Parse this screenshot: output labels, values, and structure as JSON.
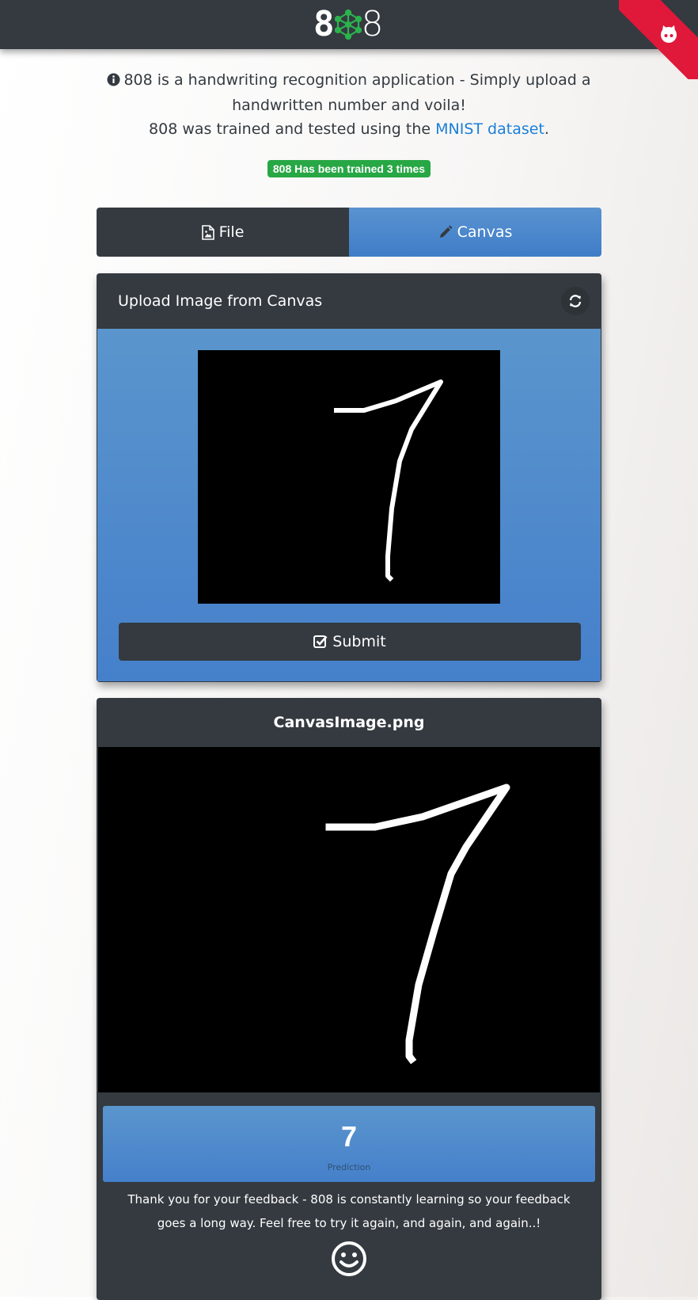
{
  "header": {
    "logo_text_left": "8",
    "logo_text_right": "8",
    "ribbon_icon": "github-octocat-icon",
    "colors": {
      "bar": "#343a40",
      "ribbon": "#e0183a"
    }
  },
  "intro": {
    "line1": "808 is a handwriting recognition application - Simply upload a handwritten number and voila!",
    "line2_prefix": "808 was trained and tested using the ",
    "link_text": "MNIST dataset",
    "line2_suffix": "."
  },
  "badge": {
    "text": "808 Has been trained 3 times",
    "color": "#28a745"
  },
  "tabs": [
    {
      "label": "File",
      "icon": "file-image-icon",
      "active": false
    },
    {
      "label": "Canvas",
      "icon": "pencil-icon",
      "active": true
    }
  ],
  "upload_card": {
    "title": "Upload Image from Canvas",
    "refresh_icon": "refresh-icon",
    "submit_label": "Submit",
    "submit_icon": "check-square-icon"
  },
  "result_card": {
    "filename": "CanvasImage.png",
    "prediction_value": "7",
    "prediction_label": "Prediction",
    "feedback": "Thank you for your feedback - 808 is constantly learning so your feedback goes a long way. Feel free to try it again, and again, and again..!",
    "smiley_icon": "smiley-icon"
  },
  "colors": {
    "accent_blue": "#4a86c9",
    "dark": "#343a40",
    "link": "#1a7fd8"
  }
}
